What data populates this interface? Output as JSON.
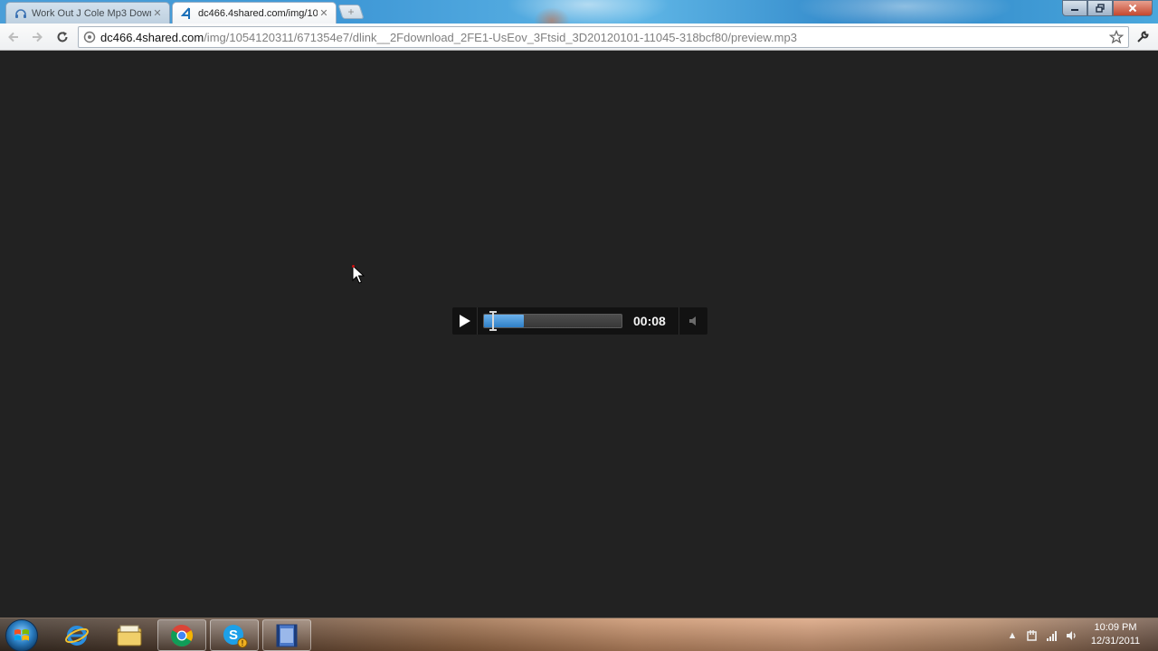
{
  "browser": {
    "tabs": [
      {
        "title": "Work Out J Cole Mp3 Down",
        "icon": "headphones-icon",
        "active": false
      },
      {
        "title": "dc466.4shared.com/img/10",
        "icon": "4shared-icon",
        "active": true
      }
    ],
    "new_tab_icon": "new-tab-icon",
    "address": {
      "host": "dc466.4shared.com",
      "path": "/img/1054120311/671354e7/dlink__2Fdownload_2FE1-UsEov_3Ftsid_3D20120101-11045-318bcf80/preview.mp3"
    },
    "accent_color": "#2f7fc6"
  },
  "player": {
    "time": "00:08",
    "progress_fraction": 0.29,
    "position_fraction": 0.06
  },
  "taskbar": {
    "clock_time": "10:09 PM",
    "clock_date": "12/31/2011",
    "pinned": [
      "internet-explorer-icon",
      "windows-explorer-icon",
      "chrome-icon",
      "skype-icon",
      "media-file-icon"
    ]
  }
}
